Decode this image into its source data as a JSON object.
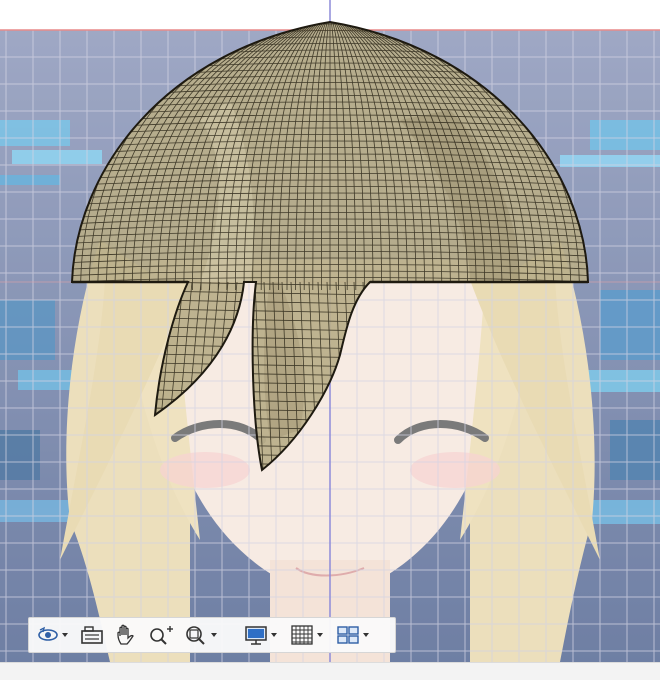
{
  "viewport": {
    "background_colors": {
      "scene": "#5a6f95",
      "hologram": "#63bfe6",
      "hair_fill": "#bfb590",
      "mesh_line": "#2b2618",
      "grid_line": "#c9c9dd",
      "axis_vertical": "#8d8bd9",
      "axis_horizontal": "#e88a8a"
    }
  },
  "toolbar": {
    "buttons": [
      {
        "name": "orbit-tool-button",
        "icon": "orbit-icon",
        "has_dropdown": true
      },
      {
        "name": "camera-button",
        "icon": "camera-icon",
        "has_dropdown": false
      },
      {
        "name": "pan-tool-button",
        "icon": "hand-icon",
        "has_dropdown": false
      },
      {
        "name": "zoom-tool-button",
        "icon": "zoom-in-icon",
        "has_dropdown": false
      },
      {
        "name": "zoom-fit-button",
        "icon": "zoom-fit-icon",
        "has_dropdown": true
      },
      {
        "name": "display-settings-button",
        "icon": "monitor-icon",
        "has_dropdown": true
      },
      {
        "name": "grid-settings-button",
        "icon": "grid-icon",
        "has_dropdown": true
      },
      {
        "name": "viewports-button",
        "icon": "viewports-icon",
        "has_dropdown": true
      }
    ]
  }
}
